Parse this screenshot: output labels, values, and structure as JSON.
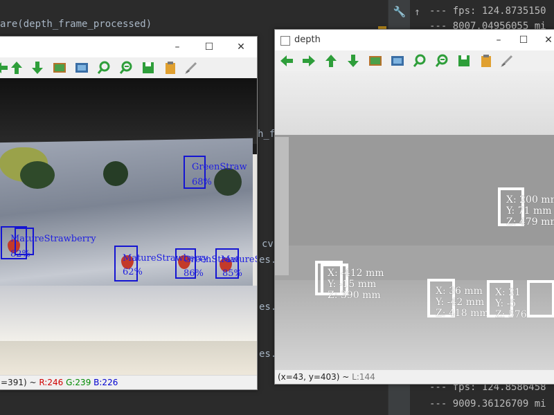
{
  "ide": {
    "code_lines": [
      "are(depth_frame_processed)",
      "h_f",
      "cv",
      "es.",
      "es.",
      "es."
    ],
    "console_lines": [
      "--- fps: 124.8735150",
      "--- 8007.04956055 mi",
      "--- fps: 124.8586458",
      "--- 9009.36126709 mi"
    ],
    "gutter_icons": [
      "wrench-icon",
      "arrow-up-icon",
      "arrow-down-icon"
    ]
  },
  "color_window": {
    "title": "",
    "status": {
      "position": "=391)",
      "separator": " ~ ",
      "r": "R:246",
      "g": "G:239",
      "b": "B:226"
    },
    "detections": [
      {
        "label": "GreenStraw",
        "conf": "68%"
      },
      {
        "label": "MatureStrawberry",
        "conf": "82%"
      },
      {
        "label": "MatureStrawberry",
        "conf": "62%"
      },
      {
        "label": "GreenStraw",
        "conf": "86%"
      },
      {
        "label": "MatureStra",
        "conf": "85%"
      }
    ]
  },
  "depth_window": {
    "title": "depth",
    "status": {
      "position": "(x=43, y=403)",
      "separator": " ~ ",
      "luma": "L:144"
    },
    "measurements": [
      {
        "x": "X: 200 mm",
        "y": "Y: 71 mm",
        "z": "Z: 479 mm"
      },
      {
        "x": "X: -412 mm",
        "y": "Y: -15 mm",
        "z": "Z: 390 mm"
      },
      {
        "x": "X: 36 mm",
        "y": "Y: -42 mm",
        "z": "Z: 418 mm"
      },
      {
        "x": "X: 21",
        "y": "Y: -5",
        "z": "Z: 576"
      }
    ]
  },
  "toolbar_buttons": [
    "arrow-left-icon",
    "arrow-right-icon",
    "arrow-up-icon",
    "arrow-down-icon",
    "image-icon",
    "fit-window-icon",
    "zoom-in-icon",
    "zoom-out-icon",
    "save-icon",
    "copy-icon",
    "properties-brush-icon"
  ],
  "colors": {
    "toolbar_green": "#2e9e3a",
    "detection_blue": "#1414d2",
    "ide_bg": "#2b2b2b",
    "status_red": "#d00000",
    "status_green": "#008a00",
    "status_blue": "#0000d0"
  }
}
